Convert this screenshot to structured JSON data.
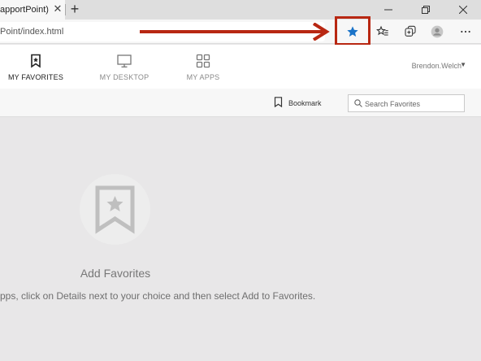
{
  "browser": {
    "tab_title": "apportPoint)",
    "address_text": "Point/index.html"
  },
  "nav": {
    "tabs": [
      {
        "label": "MY FAVORITES",
        "icon": "bookmark-star-icon",
        "active": true
      },
      {
        "label": "MY DESKTOP",
        "icon": "monitor-icon",
        "active": false
      },
      {
        "label": "MY APPS",
        "icon": "apps-grid-icon",
        "active": false
      }
    ],
    "user_name": "Brendon.Welch",
    "user_caret": "▼"
  },
  "subbar": {
    "bookmark_label": "Bookmark",
    "search_placeholder": "Search Favorites"
  },
  "empty_state": {
    "title": "Add Favorites",
    "description": "Apps, click on Details next to your choice and then select Add to Favorites."
  },
  "colors": {
    "highlight": "#b82712",
    "star_accent": "#1a73c8"
  }
}
